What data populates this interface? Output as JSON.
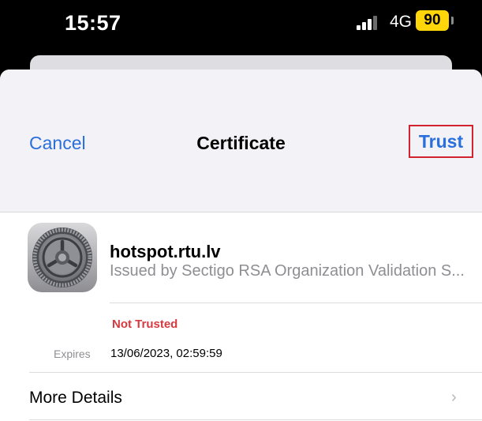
{
  "status_bar": {
    "time": "15:57",
    "network": "4G",
    "battery": "90",
    "battery_color": "#ffd60a"
  },
  "nav": {
    "cancel_label": "Cancel",
    "title": "Certificate",
    "trust_label": "Trust",
    "highlight_color": "#d1242f"
  },
  "certificate": {
    "icon": "settings-gear-icon",
    "name": "hotspot.rtu.lv",
    "issued_by": "Issued by Sectigo RSA Organization Validation S...",
    "status": "Not Trusted",
    "expires_label": "Expires",
    "expires_value": "13/06/2023, 02:59:59"
  },
  "more_details": {
    "label": "More Details",
    "chevron": "›"
  },
  "colors": {
    "accent": "#2a6fdb",
    "danger": "#d8393f"
  }
}
